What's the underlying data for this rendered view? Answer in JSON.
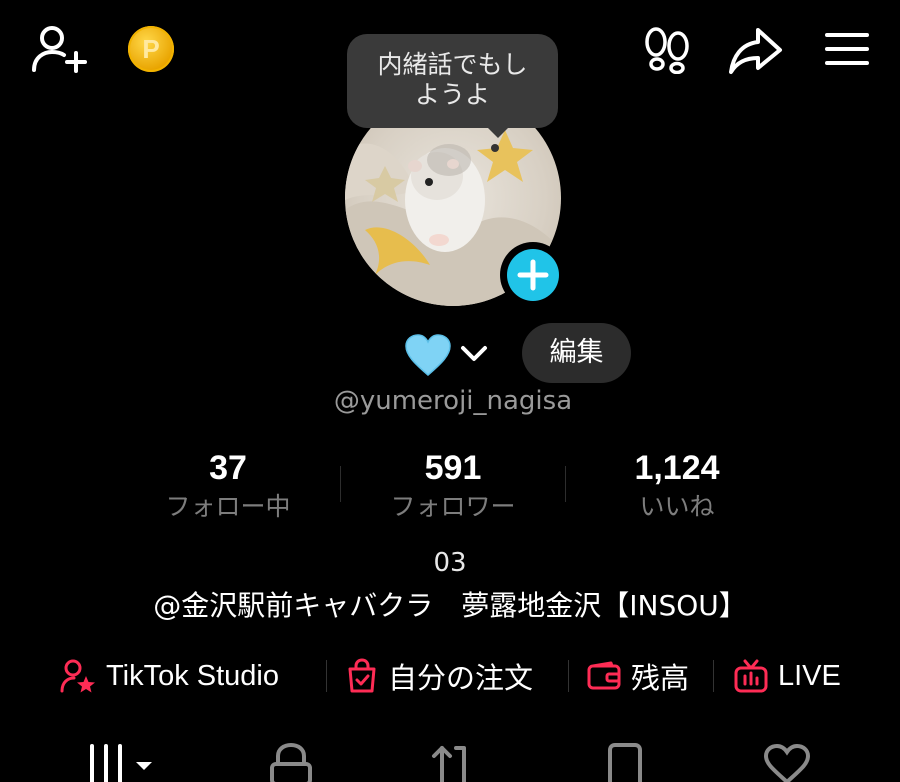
{
  "header": {
    "add_user_icon": "add-user-icon",
    "coin_icon": "coin-icon",
    "coin_letter": "P",
    "footprint_icon": "footprint-icon",
    "share_icon": "share-icon",
    "menu_icon": "menu-icon"
  },
  "profile": {
    "bubble_line1": "内緒話でもし",
    "bubble_line2": "ようよ",
    "heart_emoji": "🩵",
    "edit_label": "編集",
    "username": "@yumeroji_nagisa"
  },
  "stats": [
    {
      "value": "37",
      "label": "フォロー中"
    },
    {
      "value": "591",
      "label": "フォロワー"
    },
    {
      "value": "1,124",
      "label": "いいね"
    }
  ],
  "bio": {
    "line1": "03",
    "line2": "@金沢駅前キャバクラ　夢露地金沢【INSOU】"
  },
  "shortcuts": {
    "studio": "TikTok Studio",
    "orders": "自分の注文",
    "balance": "残高",
    "live": "LIVE"
  },
  "colors": {
    "accent_red": "#fe2c55",
    "plus_blue": "#20c4e8",
    "coin_gold": "#f2b300"
  }
}
